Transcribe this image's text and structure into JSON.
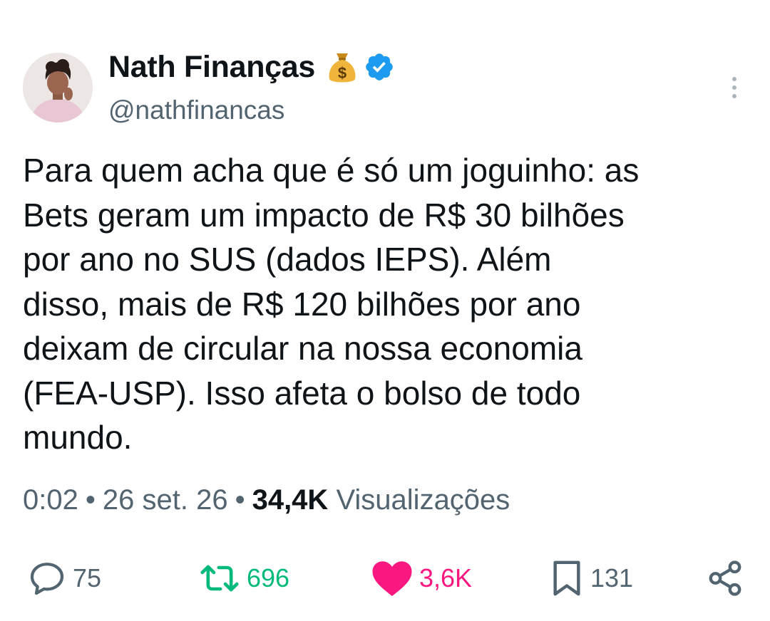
{
  "author": {
    "name": "Nath Finanças",
    "handle": "@nathfinancas",
    "name_emoji_icon": "money-bag-icon",
    "verified_icon": "verified-badge-icon",
    "verified_color": "#1d9bf0"
  },
  "tweet": {
    "text": "Para quem acha que é só um joguinho: as\nBets geram um impacto de R$ 30 bilhões\npor ano no SUS (dados IEPS). Além\ndisso, mais de R$ 120 bilhões por ano\ndeixam de circular na nossa economia\n(FEA-USP). Isso afeta o bolso de todo\nmundo."
  },
  "meta": {
    "time": "0:02",
    "date": "26 set. 26",
    "separator": "•",
    "views_count": "34,4K",
    "views_label": "Visualizações"
  },
  "actions": {
    "reply": {
      "icon": "reply-icon",
      "count": "75"
    },
    "retweet": {
      "icon": "retweet-icon",
      "count": "696",
      "color": "#00ba7c"
    },
    "like": {
      "icon": "heart-icon",
      "count": "3,6K",
      "color": "#f91880"
    },
    "bookmark": {
      "icon": "bookmark-icon",
      "count": "131"
    },
    "share": {
      "icon": "share-icon"
    }
  },
  "menu": {
    "icon": "more-options-icon"
  }
}
